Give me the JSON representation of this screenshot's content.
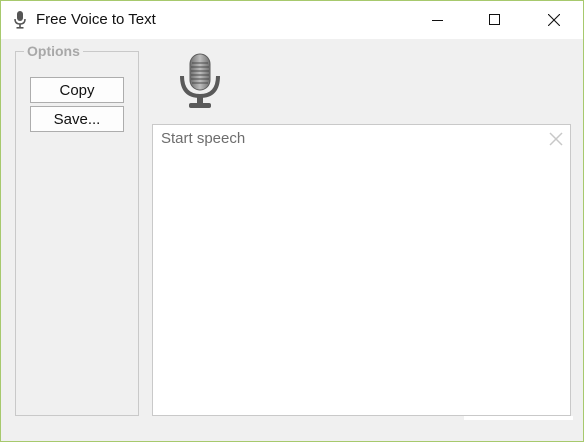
{
  "window": {
    "title": "Free Voice to Text",
    "accent_border_color": "#a7c96d",
    "controls": {
      "minimize": "minimize-icon",
      "maximize": "maximize-icon",
      "close": "close-icon"
    }
  },
  "options": {
    "legend": "Options",
    "copy_label": "Copy",
    "save_label": "Save..."
  },
  "microphone": {
    "icon": "microphone-icon"
  },
  "transcript": {
    "placeholder": "Start speech",
    "value": "",
    "clear_icon": "clear-icon"
  }
}
